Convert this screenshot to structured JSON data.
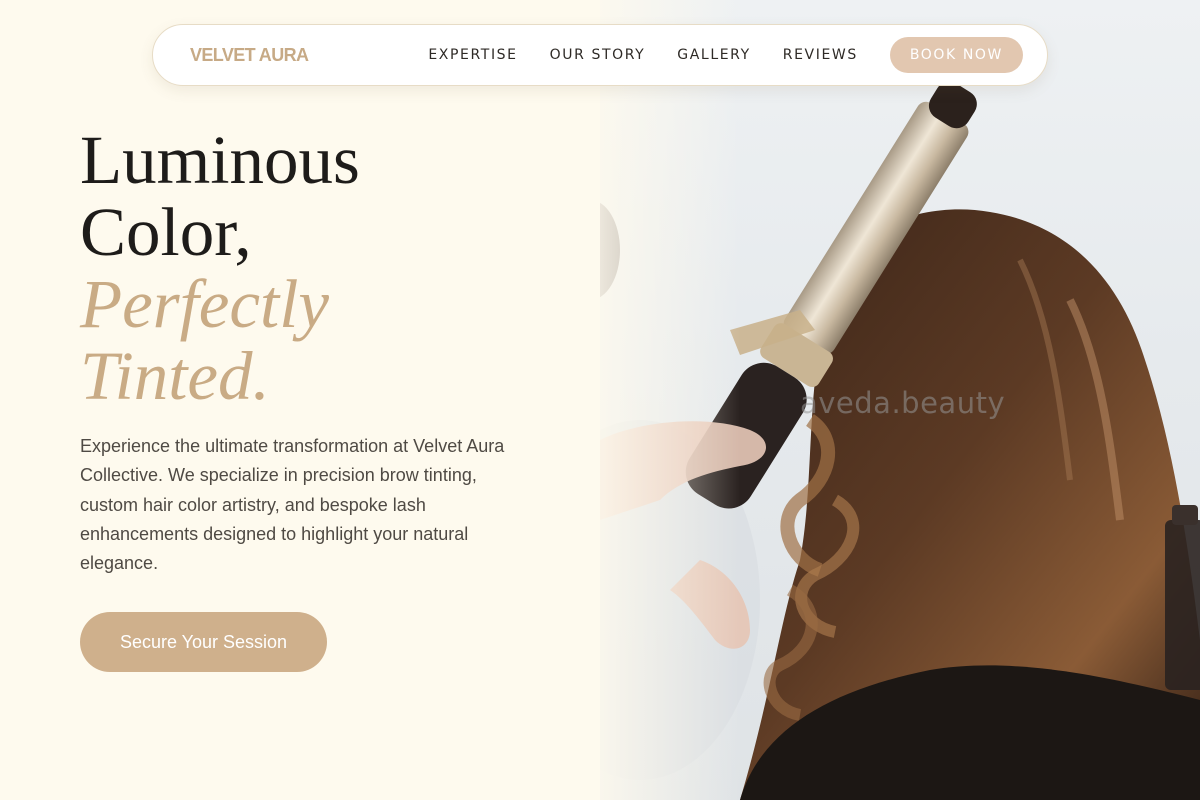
{
  "navbar": {
    "brand": "VELVET AURA",
    "links": [
      "EXPERTISE",
      "OUR STORY",
      "GALLERY",
      "REVIEWS"
    ],
    "cta_label": "BOOK NOW"
  },
  "hero": {
    "headline_line1": "Luminous",
    "headline_line2": "Color,",
    "headline_accent_line1": "Perfectly",
    "headline_accent_line2": "Tinted.",
    "description": "Experience the ultimate transformation at Velvet Aura Collective. We specialize in precision brow tinting, custom hair color artistry, and bespoke lash enhancements designed to highlight your natural elegance.",
    "cta_label": "Secure Your Session"
  },
  "photo": {
    "watermark": "aveda.beauty"
  },
  "colors": {
    "page_background": "#fefaee",
    "accent": "#c9ab85",
    "book_button": "#e2c7b0",
    "cta_button": "#cfb08c",
    "heading_text": "#1e1c1a"
  }
}
